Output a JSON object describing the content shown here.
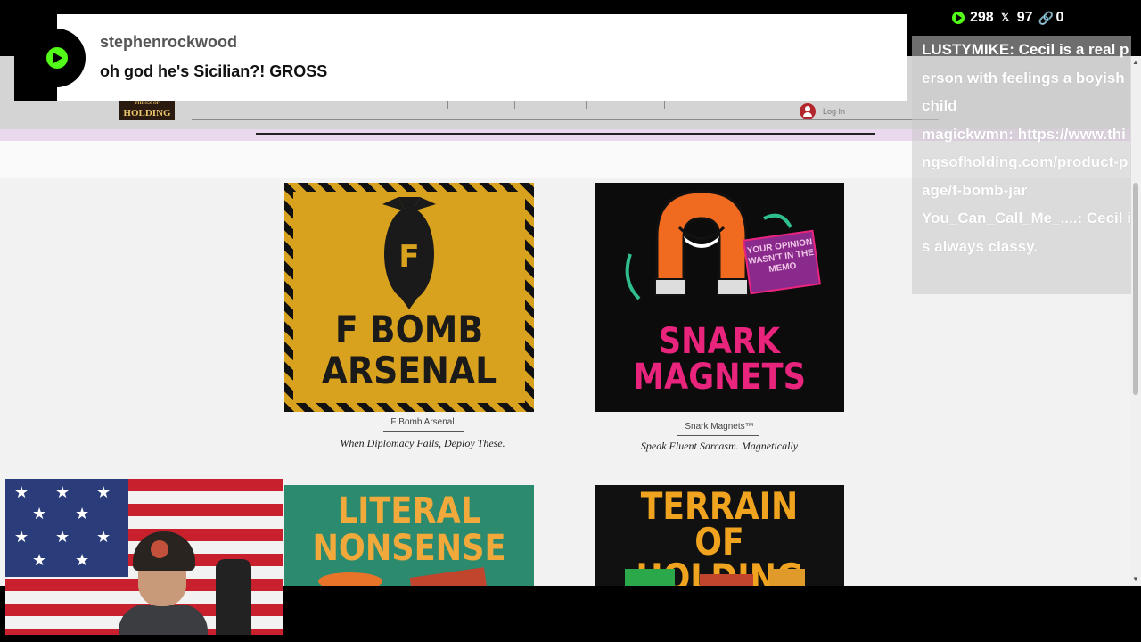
{
  "site": {
    "logo_small": "THINGS OF",
    "logo_big": "HOLDING",
    "login_label": "Log In"
  },
  "products": [
    {
      "name": "F Bomb Arsenal",
      "tagline": "When Diplomacy Fails, Deploy These.",
      "image_text_line1": "F BOMB",
      "image_text_line2": "ARSENAL",
      "image_letter": "F"
    },
    {
      "name": "Snark Magnets™",
      "tagline": "Speak Fluent Sarcasm. Magnetically",
      "image_text_line1": "SNARK",
      "image_text_line2": "MAGNETS",
      "sign_text": "YOUR OPINION WASN'T IN THE MEMO"
    },
    {
      "image_text_line1": "LITERAL",
      "image_text_line2": "NONSENSE"
    },
    {
      "image_text_line1": "TERRAIN",
      "image_text_line2": "OF HOLDING"
    }
  ],
  "alert": {
    "username": "stephenrockwood",
    "message": "oh god he's Sicilian?! GROSS"
  },
  "stats": {
    "kick_count": "298",
    "x_count": "97",
    "link_count": "0"
  },
  "chat": [
    "LUSTYMIKE: Cecil is a real person with feelings a boyish child",
    "magickwmn: https://www.thingsofholding.com/product-page/f-bomb-jar",
    "You_Can_Call_Me_....: Cecil is always classy."
  ],
  "colors": {
    "kick_green": "#53fc18",
    "flag_red": "#c8202c",
    "flag_blue": "#2a3c7a"
  }
}
